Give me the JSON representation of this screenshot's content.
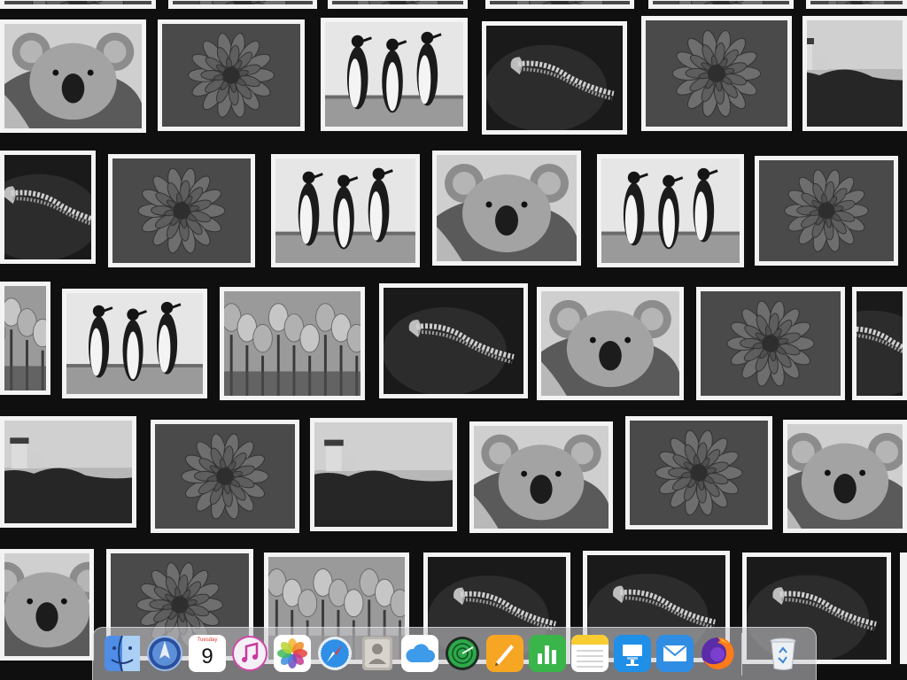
{
  "desktop": {
    "background_color": "#0f0f0f",
    "photo_frame_color": "#f3f3f3",
    "photo_subjects": [
      "koala",
      "flower",
      "penguins",
      "jellyfish",
      "lighthouse",
      "tulips"
    ]
  },
  "dock": {
    "items": [
      {
        "name": "finder",
        "icon": "finder-icon"
      },
      {
        "name": "launchpad",
        "icon": "launchpad-icon"
      },
      {
        "name": "calendar",
        "icon": "calendar-icon",
        "day_label": "Tuesday",
        "date": "9"
      },
      {
        "name": "itunes",
        "icon": "music-note-icon"
      },
      {
        "name": "photos",
        "icon": "photos-pinwheel-icon"
      },
      {
        "name": "safari",
        "icon": "compass-icon"
      },
      {
        "name": "contacts",
        "icon": "contacts-icon"
      },
      {
        "name": "icloud",
        "icon": "cloud-icon"
      },
      {
        "name": "find-my",
        "icon": "radar-icon"
      },
      {
        "name": "pages",
        "icon": "pen-icon"
      },
      {
        "name": "numbers",
        "icon": "bar-chart-icon"
      },
      {
        "name": "notes",
        "icon": "notes-icon"
      },
      {
        "name": "keynote",
        "icon": "podium-icon"
      },
      {
        "name": "mail",
        "icon": "envelope-icon"
      },
      {
        "name": "firefox",
        "icon": "firefox-icon"
      },
      {
        "name": "trash",
        "icon": "trash-icon"
      }
    ]
  }
}
